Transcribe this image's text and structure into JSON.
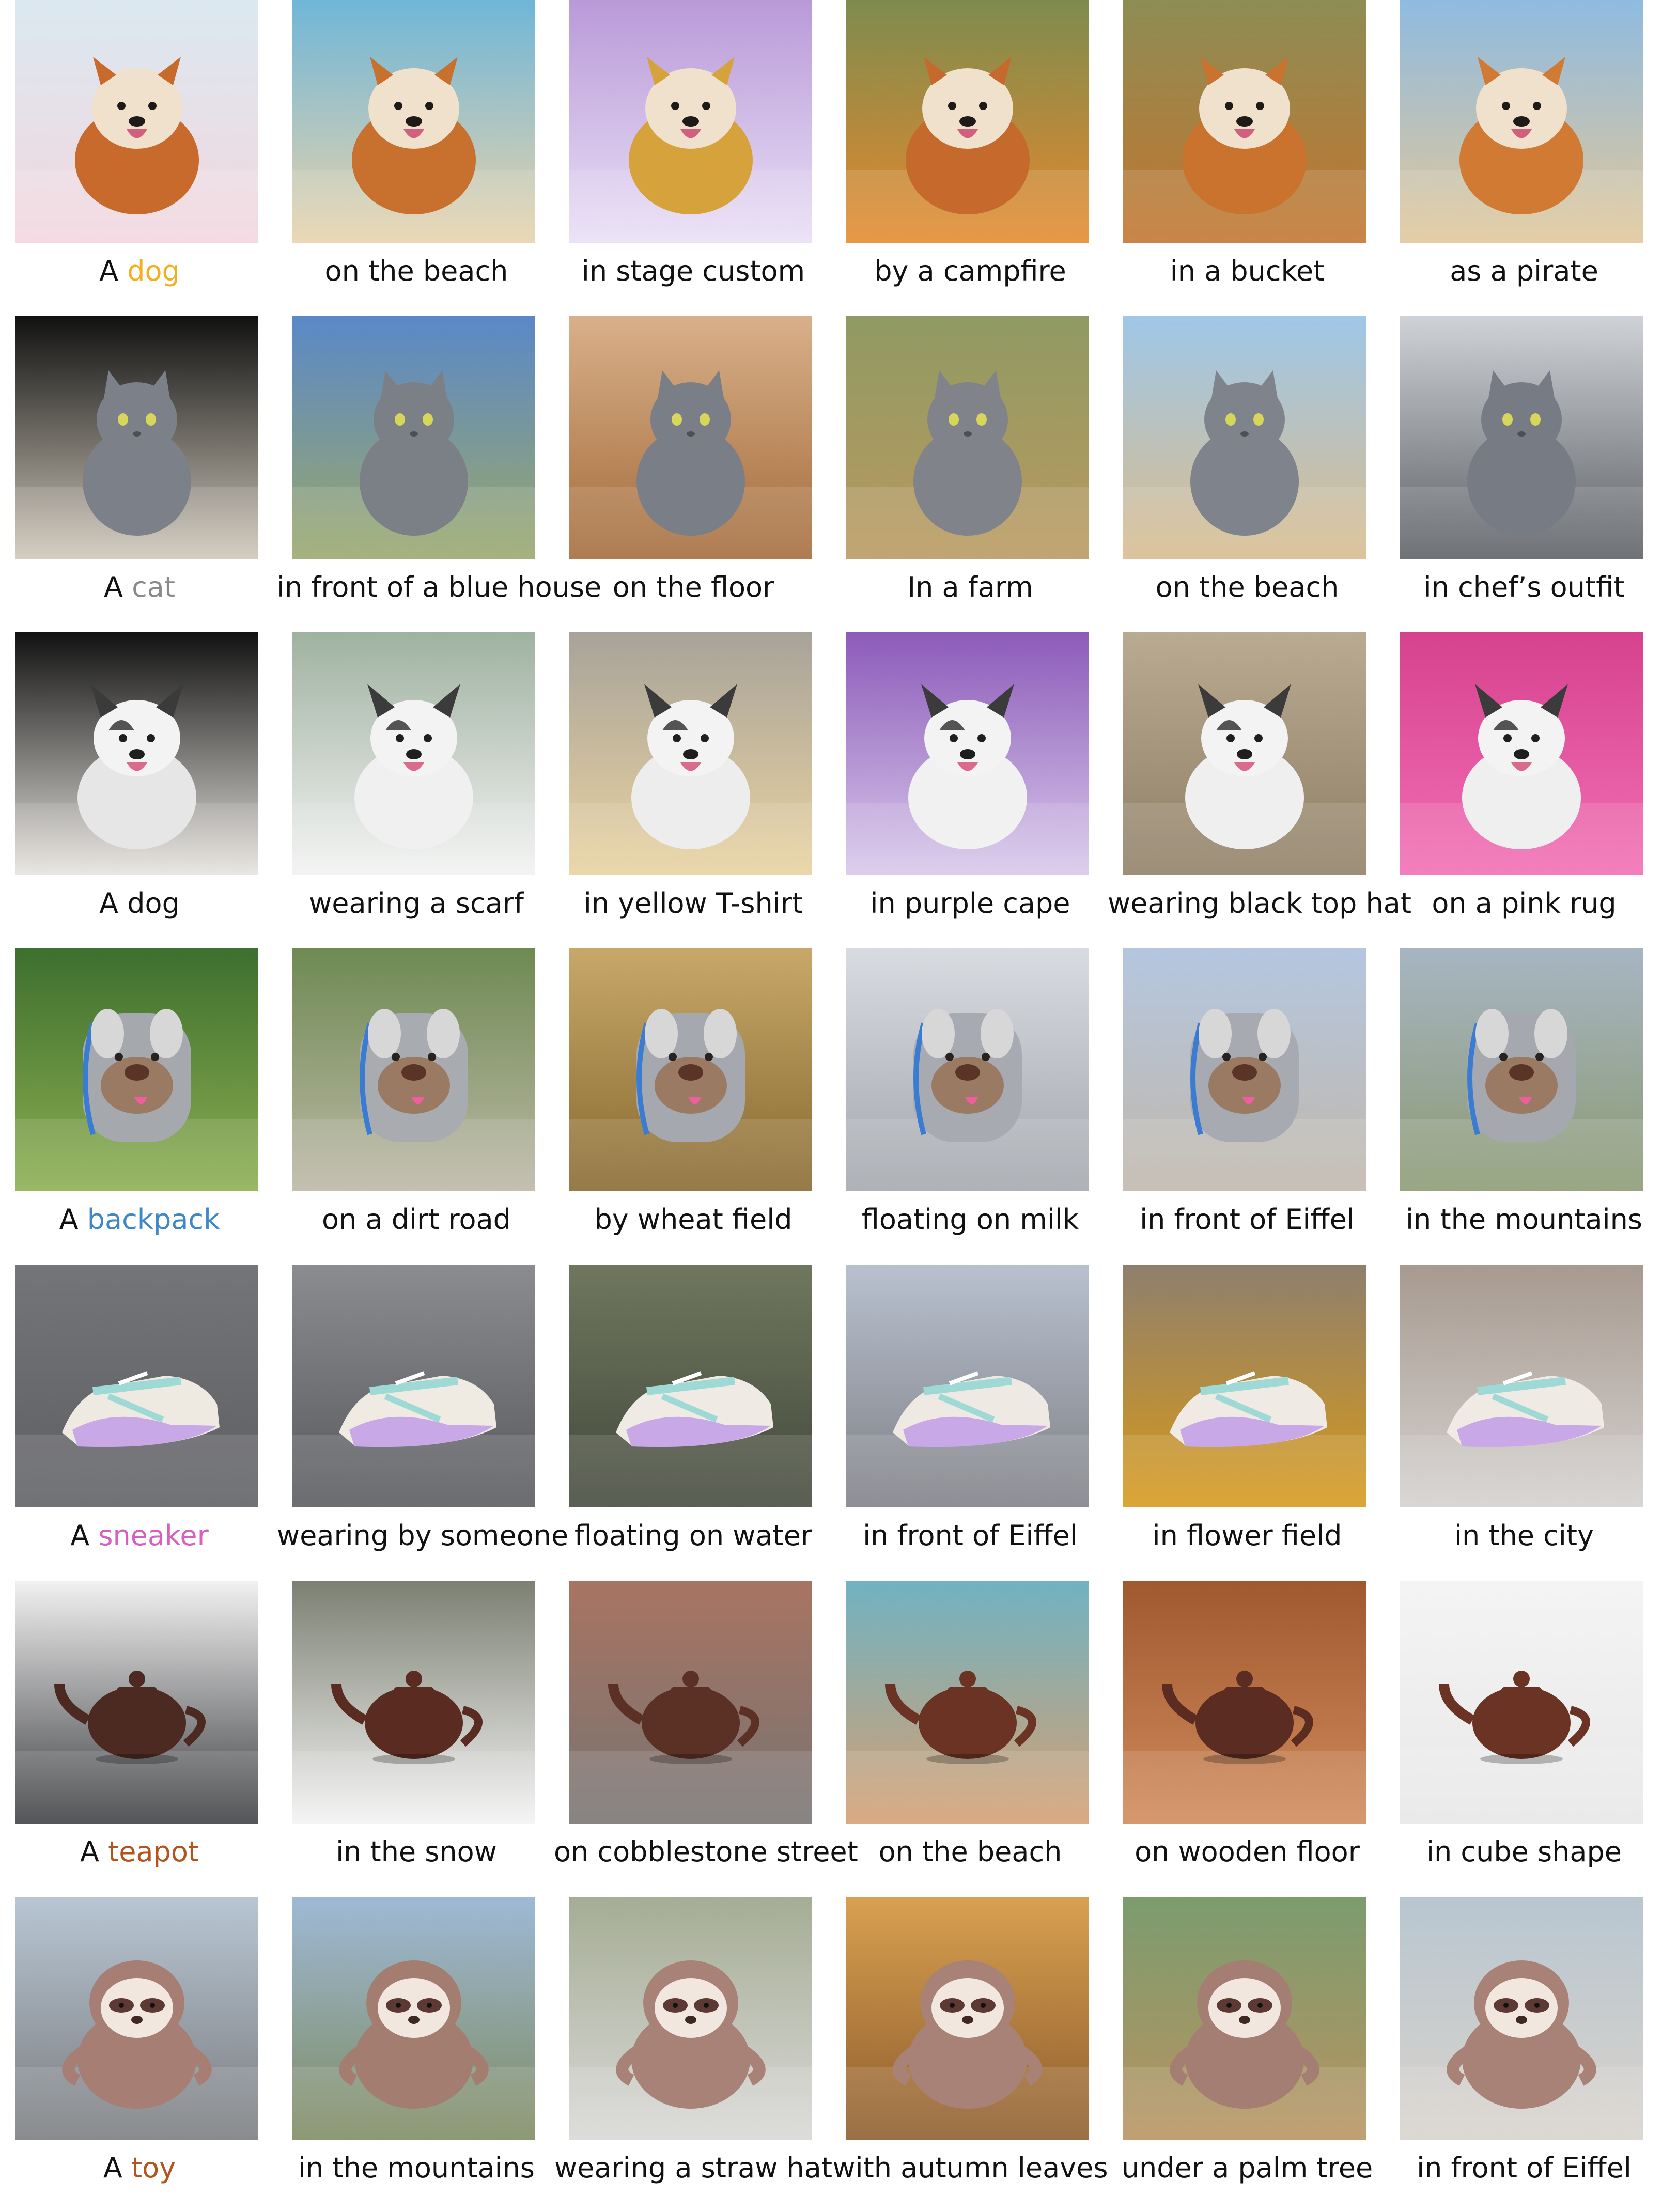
{
  "rows": [
    {
      "prefix": "A",
      "subject": "dog",
      "subject_color": "#F2B01E",
      "captions": [
        "on the beach",
        "in stage custom",
        "by a campfire",
        "in a bucket",
        "as a pirate"
      ],
      "scenes": [
        {
          "subject": "dog",
          "bg": [
            "#dbe8f0",
            "#f3d7df"
          ],
          "body": "#c86a2c"
        },
        {
          "subject": "dog",
          "bg": [
            "#6fb6d8",
            "#e8d3ac"
          ],
          "body": "#c8702e"
        },
        {
          "subject": "dog",
          "bg": [
            "#b99ad8",
            "#e9dff5"
          ],
          "body": "#d6a23c"
        },
        {
          "subject": "dog",
          "bg": [
            "#7d8b4f",
            "#e58a2d"
          ],
          "body": "#c6692c"
        },
        {
          "subject": "dog",
          "bg": [
            "#8d8d55",
            "#c2752e"
          ],
          "body": "#c9732f"
        },
        {
          "subject": "dog",
          "bg": [
            "#8fbbe0",
            "#e1c79a"
          ],
          "body": "#d07a34"
        }
      ]
    },
    {
      "prefix": "A",
      "subject": "cat",
      "subject_color": "#8A8A8A",
      "captions": [
        "in front of a blue house",
        "on the floor",
        "In a farm",
        "on the beach",
        "in chef’s outfit"
      ],
      "scenes": [
        {
          "subject": "cat",
          "bg": [
            "#111111",
            "#cfc8ba"
          ],
          "body": "#7c8088"
        },
        {
          "subject": "cat",
          "bg": [
            "#5a88c8",
            "#9aa86b"
          ],
          "body": "#7b7f86"
        },
        {
          "subject": "cat",
          "bg": [
            "#d8b08a",
            "#a46b3a"
          ],
          "body": "#7a7e87"
        },
        {
          "subject": "cat",
          "bg": [
            "#8f9a63",
            "#b9995f"
          ],
          "body": "#80848a"
        },
        {
          "subject": "cat",
          "bg": [
            "#9fc7e8",
            "#d8bc8d"
          ],
          "body": "#7f848c"
        },
        {
          "subject": "cat",
          "bg": [
            "#cfd2d6",
            "#5c5f64"
          ],
          "body": "#767b84"
        }
      ]
    },
    {
      "prefix": "A",
      "subject": "dog",
      "subject_color": "#111111",
      "captions": [
        "wearing a scarf",
        "in yellow T-shirt",
        "in purple cape",
        "wearing black top hat",
        "on a pink rug"
      ],
      "scenes": [
        {
          "subject": "dog2",
          "bg": [
            "#111111",
            "#e7e4df"
          ],
          "body": "#e6e6e6"
        },
        {
          "subject": "dog2",
          "bg": [
            "#9fb2a0",
            "#f2f2f2"
          ],
          "body": "#f0f0f0"
        },
        {
          "subject": "dog2",
          "bg": [
            "#a8a39a",
            "#e9d2a0"
          ],
          "body": "#ededed"
        },
        {
          "subject": "dog2",
          "bg": [
            "#8c5bb9",
            "#d8c8ea"
          ],
          "body": "#f1f1f1"
        },
        {
          "subject": "dog2",
          "bg": [
            "#b9aa92",
            "#8f7f65"
          ],
          "body": "#efefef"
        },
        {
          "subject": "dog2",
          "bg": [
            "#d6428e",
            "#f26eb5"
          ],
          "body": "#efefef"
        }
      ]
    },
    {
      "prefix": "A",
      "subject": "backpack",
      "subject_color": "#3F88C8",
      "captions": [
        "on a dirt road",
        "by wheat field",
        "floating on milk",
        "in front of Eiffel",
        "in the mountains"
      ],
      "scenes": [
        {
          "subject": "backpack",
          "bg": [
            "#3d6f2e",
            "#8cae50"
          ],
          "body": "#a5a8ad"
        },
        {
          "subject": "backpack",
          "bg": [
            "#6e8a52",
            "#bdb8a7"
          ],
          "body": "#a8abb0"
        },
        {
          "subject": "backpack",
          "bg": [
            "#c8a86a",
            "#87692f"
          ],
          "body": "#a5a8ae"
        },
        {
          "subject": "backpack",
          "bg": [
            "#d8dbe0",
            "#a3a7ad"
          ],
          "body": "#a7aab0"
        },
        {
          "subject": "backpack",
          "bg": [
            "#b4c7df",
            "#c1b7ab"
          ],
          "body": "#a7aab0"
        },
        {
          "subject": "backpack",
          "bg": [
            "#a7b5c3",
            "#8b9a73"
          ],
          "body": "#a5a8ae"
        }
      ]
    },
    {
      "prefix": "A",
      "subject": "sneaker",
      "subject_color": "#D85FBF",
      "captions": [
        "wearing by someone",
        "floating on water",
        "in front of Eiffel",
        "in flower field",
        "in the city"
      ],
      "scenes": [
        {
          "subject": "sneaker",
          "bg": [
            "#747579",
            "#5e5f63"
          ],
          "body": "#eeeae2"
        },
        {
          "subject": "sneaker",
          "bg": [
            "#8b8c8f",
            "#58595d"
          ],
          "body": "#efeae2"
        },
        {
          "subject": "sneaker",
          "bg": [
            "#6f775e",
            "#44493c"
          ],
          "body": "#efebe4"
        },
        {
          "subject": "sneaker",
          "bg": [
            "#b8c1cf",
            "#7f8086"
          ],
          "body": "#eeeae3"
        },
        {
          "subject": "sneaker",
          "bg": [
            "#8e7f6d",
            "#d79a1b"
          ],
          "body": "#efebe4"
        },
        {
          "subject": "sneaker",
          "bg": [
            "#a79a90",
            "#d4d1cf"
          ],
          "body": "#efebe4"
        }
      ]
    },
    {
      "prefix": "A",
      "subject": "teapot",
      "subject_color": "#B3541E",
      "captions": [
        "in the snow",
        "on cobblestone street",
        "on the beach",
        "on wooden floor",
        "in cube shape"
      ],
      "scenes": [
        {
          "subject": "teapot",
          "bg": [
            "#f1f1f1",
            "#3e3f42"
          ],
          "body": "#4c2a22"
        },
        {
          "subject": "teapot",
          "bg": [
            "#7c8072",
            "#f3f3f3"
          ],
          "body": "#5a2b20"
        },
        {
          "subject": "teapot",
          "bg": [
            "#a97462",
            "#777472"
          ],
          "body": "#5b3025"
        },
        {
          "subject": "teapot",
          "bg": [
            "#70b3c2",
            "#d49f72"
          ],
          "body": "#6b3323"
        },
        {
          "subject": "teapot",
          "bg": [
            "#a0582f",
            "#d08a5a"
          ],
          "body": "#5a2c22"
        },
        {
          "subject": "teapot",
          "bg": [
            "#f4f4f4",
            "#e8e8e8"
          ],
          "body": "#6b3324"
        }
      ]
    },
    {
      "prefix": "A",
      "subject": "toy",
      "subject_color": "#B3541E",
      "captions": [
        "in the mountains",
        "wearing a straw hat",
        "with autumn leaves",
        "under a palm tree",
        "in front of Eiffel"
      ],
      "scenes": [
        {
          "subject": "toy",
          "bg": [
            "#b8c6d3",
            "#7a7c7f"
          ],
          "body": "#a67e73"
        },
        {
          "subject": "toy",
          "bg": [
            "#9eb9d6",
            "#7e8b61"
          ],
          "body": "#a47d71"
        },
        {
          "subject": "toy",
          "bg": [
            "#a5ad95",
            "#d9d8d6"
          ],
          "body": "#a88276"
        },
        {
          "subject": "toy",
          "bg": [
            "#d8a050",
            "#8d5c2c"
          ],
          "body": "#a88276"
        },
        {
          "subject": "toy",
          "bg": [
            "#7b9c6f",
            "#b89360"
          ],
          "body": "#a47e72"
        },
        {
          "subject": "toy",
          "bg": [
            "#b8c6d0",
            "#d9d3cc"
          ],
          "body": "#a88276"
        }
      ]
    }
  ]
}
